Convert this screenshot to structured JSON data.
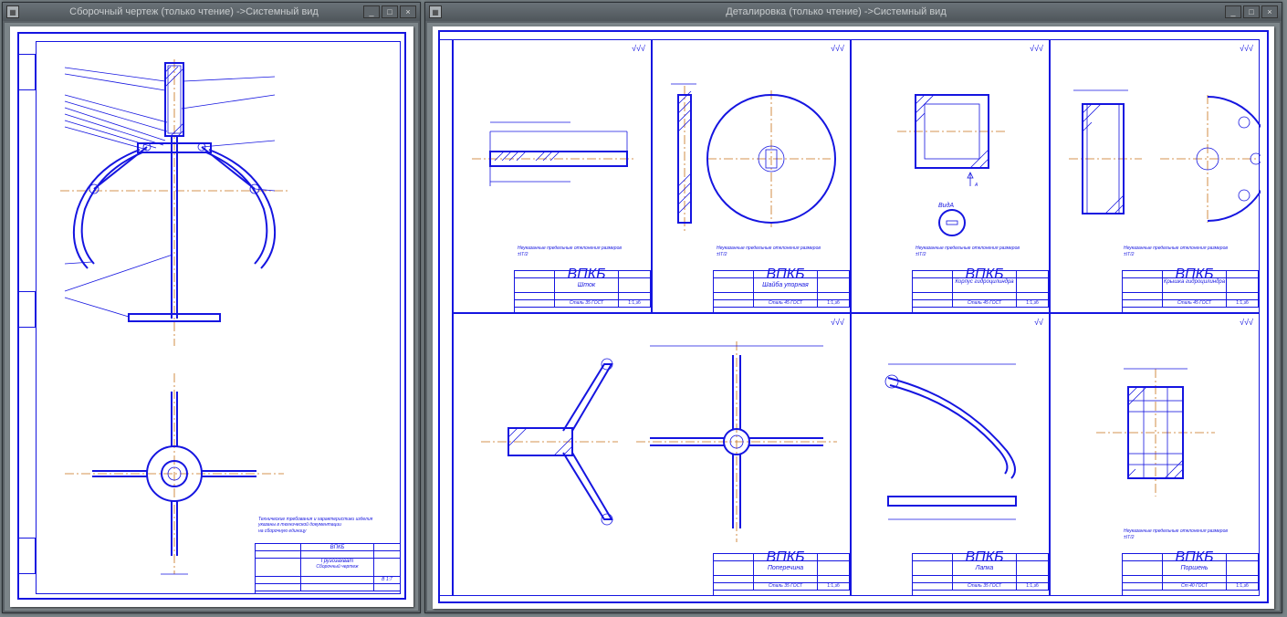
{
  "windows": {
    "left": {
      "title": "Сборочный чертеж (только чтение) ->Системный вид",
      "btn_min": "_",
      "btn_max": "□",
      "btn_close": "×",
      "main_title": "Грузозахват",
      "main_sub": "Сборочный чертеж",
      "code": "ВПКБ",
      "scale": "В 1:7"
    },
    "right": {
      "title": "Деталировка (только чтение) ->Системный вид",
      "btn_min": "_",
      "btn_max": "□",
      "btn_close": "×"
    }
  },
  "details": [
    {
      "name": "Шток",
      "mat": "Сталь 35 ГОСТ",
      "code": "ВПКБ",
      "scale": "1:1,зб",
      "rough": "√√√"
    },
    {
      "name": "Шайба упорная",
      "mat": "Сталь 45 ГОСТ",
      "code": "ВПКБ",
      "scale": "1:1,зб",
      "rough": "√√√"
    },
    {
      "name": "Корпус гидроцилиндра",
      "mat": "Сталь 45 ГОСТ",
      "code": "ВПКБ",
      "scale": "1:1,зб",
      "rough": "√√√",
      "vida": "ВидА"
    },
    {
      "name": "Крышка гидроцилиндра",
      "mat": "Сталь 45 ГОСТ",
      "code": "ВПКБ",
      "scale": "1:1,зб",
      "rough": "√√√"
    },
    {
      "name": "Поперечина",
      "mat": "Сталь 35 ГОСТ",
      "code": "ВПКБ",
      "scale": "1:1,зб",
      "rough": "√√√"
    },
    {
      "name": "Лапка",
      "mat": "Сталь 35 ГОСТ",
      "code": "ВПКБ",
      "scale": "1:1,зб",
      "rough": "√√√",
      "alt_rough": "√√"
    },
    {
      "name": "Поршень",
      "mat": "Ст 40 ГОСТ",
      "code": "ВПКБ",
      "scale": "1:1,зб",
      "rough": "√√√"
    }
  ]
}
